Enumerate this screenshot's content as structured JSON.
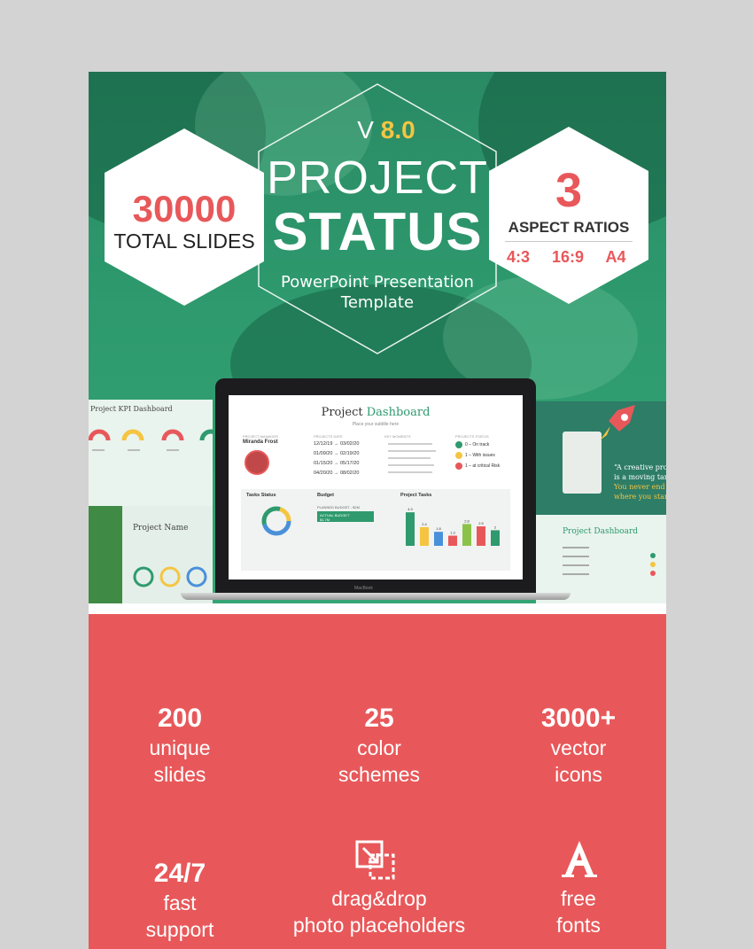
{
  "badge_left": {
    "number": "30000",
    "label": "TOTAL SLIDES"
  },
  "center": {
    "version_prefix": "V ",
    "version": "8.0",
    "title_line1": "PROJECT",
    "title_line2": "STATUS",
    "subtitle_line1": "PowerPoint Presentation",
    "subtitle_line2": "Template"
  },
  "badge_right": {
    "number": "3",
    "label": "ASPECT RATIOS",
    "ratios": [
      "4:3",
      "16:9",
      "A4"
    ]
  },
  "previews": {
    "left_top_title": "Project KPI Dashboard",
    "left_bottom_title": "Project Name",
    "right_quote_1": "“A creative proje",
    "right_quote_2": "is a moving targ",
    "right_quote_3": "You never end u",
    "right_quote_4": "where you start,",
    "right_bottom_title": "Project Dashboard"
  },
  "screen": {
    "title_a": "Project ",
    "title_b": "Dashboard",
    "subtitle": "Place your subtitle here",
    "manager_heading": "PROJECT MANAGER",
    "manager_name": "Miranda Frost",
    "dates_heading": "PROJECTS DATE",
    "dates": [
      "12/12/19 → 03/02/20",
      "01/09/20 → 02/19/20",
      "01/15/20 → 05/17/20",
      "04/20/20 → 08/02/20"
    ],
    "moments_heading": "KEY MOMENTS",
    "status_heading": "PROJECTS STATUS",
    "status_items": [
      "0 – On track",
      "1 – With issues",
      "1 – at critical Risk"
    ],
    "tasks_status": "Tasks Status",
    "budget": "Budget",
    "planned_budget": "PLANNED BUDGET - $2M",
    "actual_budget": "ACTUAL BUDGET",
    "actual_value": "$1.7M",
    "project_tasks": "Project Tasks",
    "bar_values": [
      4.3,
      2.4,
      1.8,
      1.3,
      2.8,
      2.5,
      2.0
    ],
    "macbook": "MacBook"
  },
  "features": [
    {
      "num": "200",
      "line1": "unique",
      "line2": "slides"
    },
    {
      "num": "25",
      "line1": "color",
      "line2": "schemes"
    },
    {
      "num": "3000+",
      "line1": "vector",
      "line2": "icons"
    },
    {
      "num": "24/7",
      "line1": "fast",
      "line2": "support"
    },
    {
      "num": "",
      "line1": "drag&drop",
      "line2": "photo placeholders"
    },
    {
      "num": "",
      "line1": "free",
      "line2": "fonts"
    }
  ],
  "colors": {
    "red": "#e8585a",
    "green": "#2e9a6e",
    "yellow": "#f5c542"
  },
  "icons": [
    "drag-drop-icon",
    "font-icon"
  ]
}
